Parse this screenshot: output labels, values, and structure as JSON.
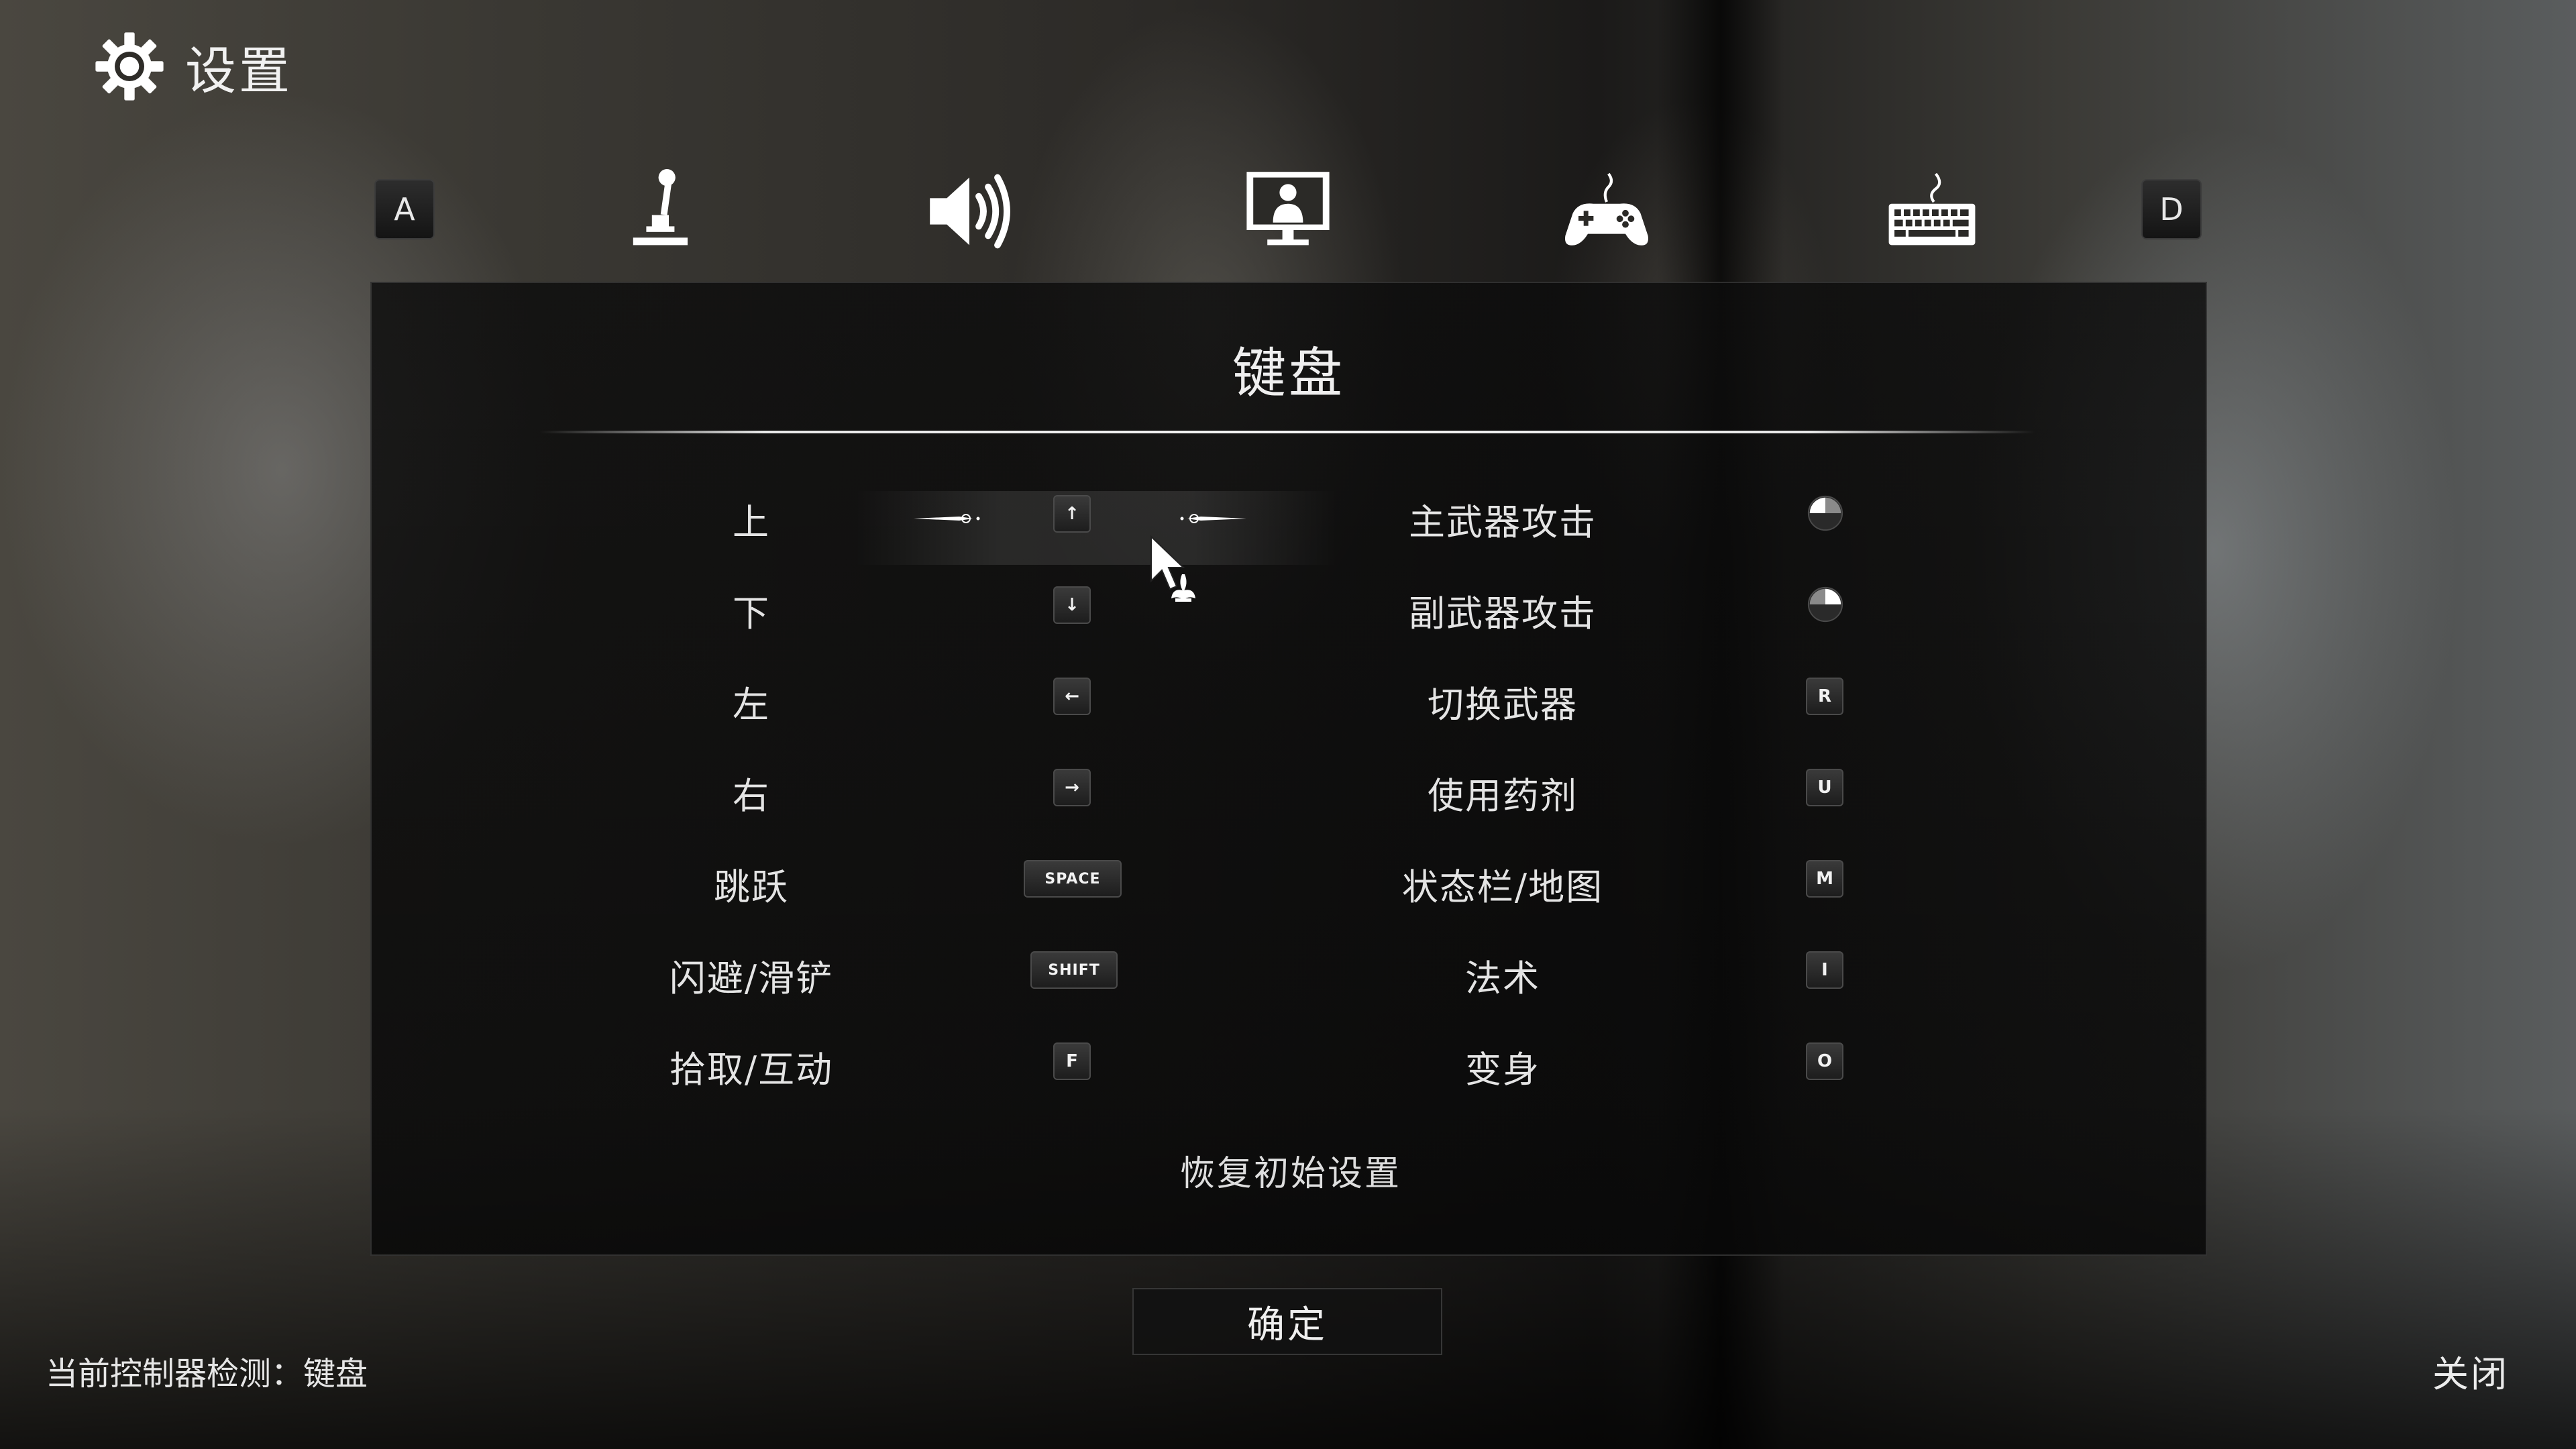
{
  "header": {
    "title": "设置",
    "icon": "gear-icon"
  },
  "tab_nav": {
    "prev_key": "A",
    "next_key": "D",
    "tabs": [
      {
        "icon": "joystick-icon"
      },
      {
        "icon": "speaker-icon"
      },
      {
        "icon": "monitor-icon"
      },
      {
        "icon": "gamepad-icon"
      },
      {
        "icon": "keyboard-icon",
        "active": true
      }
    ]
  },
  "panel": {
    "title": "键盘",
    "left_bindings": [
      {
        "label": "上",
        "key": "↑"
      },
      {
        "label": "下",
        "key": "↓"
      },
      {
        "label": "左",
        "key": "←"
      },
      {
        "label": "右",
        "key": "→"
      },
      {
        "label": "跳跃",
        "key": "SPACE"
      },
      {
        "label": "闪避/滑铲",
        "key": "SHIFT"
      },
      {
        "label": "拾取/互动",
        "key": "F"
      }
    ],
    "right_bindings": [
      {
        "label": "主武器攻击",
        "key": "mouse-left"
      },
      {
        "label": "副武器攻击",
        "key": "mouse-right"
      },
      {
        "label": "切换武器",
        "key": "R"
      },
      {
        "label": "使用药剂",
        "key": "U"
      },
      {
        "label": "状态栏/地图",
        "key": "M"
      },
      {
        "label": "法术",
        "key": "I"
      },
      {
        "label": "变身",
        "key": "O"
      }
    ],
    "reset_label": "恢复初始设置"
  },
  "confirm_label": "确定",
  "controller_status": "当前控制器检测：键盘",
  "close_label": "关闭",
  "colors": {
    "panel_bg": "#0c0c0c",
    "text": "#e6e6e6",
    "key_bg": "#2a2a2a"
  }
}
